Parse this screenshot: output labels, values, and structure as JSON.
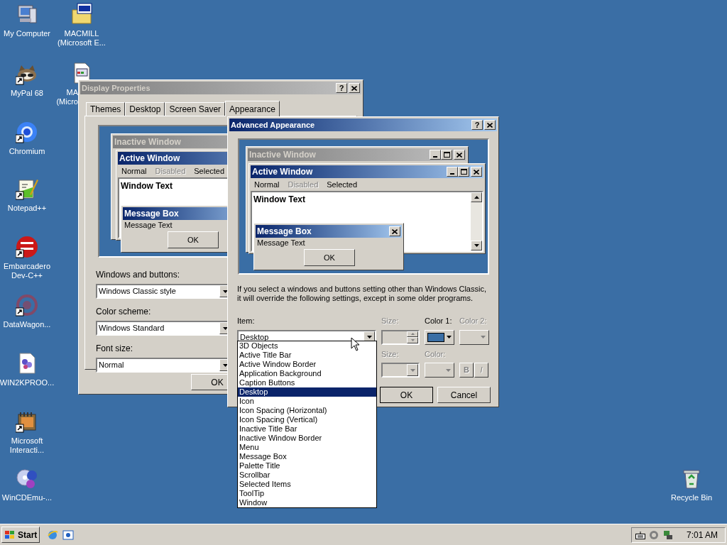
{
  "desktop": {
    "icons": [
      {
        "lines": [
          "My Computer"
        ],
        "shortcut": false
      },
      {
        "lines": [
          "MACMILL",
          "(Microsoft E..."
        ],
        "shortcut": false
      },
      {
        "lines": [
          "MyPal 68"
        ],
        "shortcut": true
      },
      {
        "lines": [
          "MA",
          "(Micro"
        ],
        "shortcut": false
      },
      {
        "lines": [
          "Chromium"
        ],
        "shortcut": true
      },
      {
        "lines": [
          "Notepad++"
        ],
        "shortcut": true
      },
      {
        "lines": [
          "Embarcadero",
          "Dev-C++"
        ],
        "shortcut": true
      },
      {
        "lines": [
          "DataWagon..."
        ],
        "shortcut": true
      },
      {
        "lines": [
          "WIN2KPROO..."
        ],
        "shortcut": false
      },
      {
        "lines": [
          "Microsoft",
          "Interacti..."
        ],
        "shortcut": true
      },
      {
        "lines": [
          "WinCDEmu-..."
        ],
        "shortcut": false
      },
      {
        "lines": [
          "Recycle Bin"
        ],
        "shortcut": false
      }
    ]
  },
  "display_properties": {
    "title": "Display Properties",
    "active": false,
    "help": "?",
    "tabs": [
      {
        "label": "Themes",
        "selected": false
      },
      {
        "label": "Desktop",
        "selected": false
      },
      {
        "label": "Screen Saver",
        "selected": false
      },
      {
        "label": "Appearance",
        "selected": true
      }
    ],
    "preview": {
      "inactive_title": "Inactive Window",
      "active_title": "Active Window",
      "menu": [
        {
          "label": "Normal",
          "disabled": false
        },
        {
          "label": "Disabled",
          "disabled": true
        },
        {
          "label": "Selected",
          "disabled": false
        }
      ],
      "window_text": "Window Text",
      "message_box_title": "Message Box",
      "message_text": "Message Text",
      "ok": "OK"
    },
    "fields": [
      {
        "label": "Windows and buttons:",
        "value": "Windows Classic style"
      },
      {
        "label": "Color scheme:",
        "value": "Windows Standard"
      },
      {
        "label": "Font size:",
        "value": "Normal"
      }
    ],
    "ok": "OK"
  },
  "advanced_appearance": {
    "title": "Advanced Appearance",
    "active": true,
    "help": "?",
    "preview": {
      "inactive_title": "Inactive Window",
      "active_title": "Active Window",
      "menu": [
        {
          "label": "Normal",
          "disabled": false
        },
        {
          "label": "Disabled",
          "disabled": true
        },
        {
          "label": "Selected",
          "disabled": false
        }
      ],
      "window_text": "Window Text",
      "message_box_title": "Message Box",
      "message_text": "Message Text",
      "ok": "OK"
    },
    "note": "If you select a windows and buttons setting other than Windows Classic,\nit will override the following settings, except in some older programs.",
    "item": {
      "label": "Item:",
      "value": "Desktop",
      "options": [
        {
          "label": "3D Objects",
          "selected": false
        },
        {
          "label": "Active Title Bar",
          "selected": false
        },
        {
          "label": "Active Window Border",
          "selected": false
        },
        {
          "label": "Application Background",
          "selected": false
        },
        {
          "label": "Caption Buttons",
          "selected": false
        },
        {
          "label": "Desktop",
          "selected": true
        },
        {
          "label": "Icon",
          "selected": false
        },
        {
          "label": "Icon Spacing (Horizontal)",
          "selected": false
        },
        {
          "label": "Icon Spacing (Vertical)",
          "selected": false
        },
        {
          "label": "Inactive Title Bar",
          "selected": false
        },
        {
          "label": "Inactive Window Border",
          "selected": false
        },
        {
          "label": "Menu",
          "selected": false
        },
        {
          "label": "Message Box",
          "selected": false
        },
        {
          "label": "Palette Title",
          "selected": false
        },
        {
          "label": "Scrollbar",
          "selected": false
        },
        {
          "label": "Selected Items",
          "selected": false
        },
        {
          "label": "ToolTip",
          "selected": false
        },
        {
          "label": "Window",
          "selected": false
        }
      ]
    },
    "size": {
      "label": "Size:",
      "disabled": true
    },
    "color1": {
      "label": "Color 1:",
      "disabled": false,
      "color": "#3a6ea5"
    },
    "color2": {
      "label": "Color 2:",
      "disabled": true
    },
    "font_size": {
      "label": "Size:",
      "disabled": true
    },
    "font_color": {
      "label": "Color:",
      "disabled": true
    },
    "bold": {
      "label": "B",
      "disabled": true
    },
    "italic": {
      "label": "I",
      "disabled": true
    },
    "ok": "OK",
    "cancel": "Cancel"
  },
  "taskbar": {
    "start": "Start",
    "clock": "7:01 AM"
  }
}
